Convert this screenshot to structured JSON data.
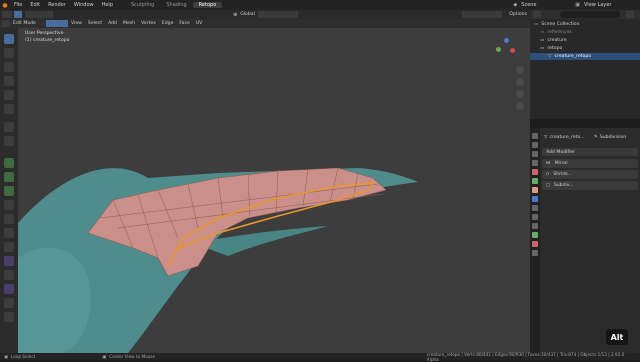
{
  "top_menu": {
    "items": [
      "File",
      "Edit",
      "Render",
      "Window",
      "Help"
    ],
    "workspaces": [
      "Sculpting",
      "Shading",
      "Retopo"
    ],
    "active_workspace": "Retopo",
    "scene_label": "Scene",
    "view_layer_label": "View Layer"
  },
  "viewport_header": {
    "mode": "Edit Mode",
    "menus": [
      "View",
      "Select",
      "Add",
      "Mesh",
      "Vertex",
      "Edge",
      "Face",
      "UV"
    ],
    "transform_orientation": "Global",
    "options": "Options"
  },
  "viewport": {
    "view_name": "User Perspective",
    "object_name": "(1) creature_retopo"
  },
  "outliner": {
    "title": "Scene Collection",
    "rows": [
      {
        "name": "references",
        "indent": 1
      },
      {
        "name": "creature",
        "indent": 1
      },
      {
        "name": "retopo",
        "indent": 1
      },
      {
        "name": "creature_retopo",
        "indent": 2,
        "selected": true
      }
    ]
  },
  "properties": {
    "object_name": "creature_reto...",
    "modifier_name": "Subdivision",
    "add_modifier_label": "Add Modifier",
    "modifiers": [
      "Mirror",
      "Shrink...",
      "Subdiv..."
    ]
  },
  "statusbar": {
    "left1": "Loop Select",
    "left2": "Center View to Mouse",
    "stats": "creature_retopo | Verts:80/441 | Edges:90/930 | Faces:30/437 | Tris:874 | Objects:1/13 | 2.93.0 Alpha"
  },
  "key_overlay": "Alt",
  "colors": {
    "active_tab": "#3d3d3d",
    "selection_blue": "#2d4f7c",
    "mesh_teal": "#4f8c8c",
    "retopo_pink": "#c98f88",
    "selected_edge": "#e8962e"
  },
  "icons": {
    "gizmo_x": "#d14a4a",
    "gizmo_y": "#6aa84f",
    "gizmo_z": "#4a7dd1"
  }
}
